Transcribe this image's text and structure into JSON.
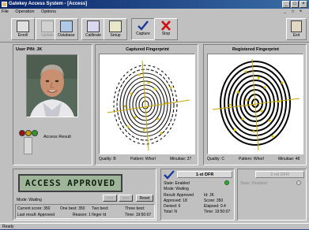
{
  "window": {
    "title": "Gatekey Access System - [Access]",
    "controls": {
      "minimize": "_",
      "maximize": "□",
      "close": "×"
    },
    "inner_controls": {
      "minimize": "_",
      "restore": "□",
      "close": "×"
    }
  },
  "menu": [
    "File",
    "Operation",
    "Options"
  ],
  "toolbar": {
    "enroll": "Enroll",
    "update": "Update",
    "database": "Database",
    "calibrate": "Calibrate",
    "setup": "Setup",
    "capture": "Capture",
    "stop": "Stop",
    "exit": "Exit"
  },
  "user": {
    "pin_label": "User PIN:  JK"
  },
  "captured": {
    "title": "Captured Fingerprint",
    "quality": "Quality: B",
    "pattern": "Pattern: Whorl",
    "minutiae": "Minutiae:  37"
  },
  "registered": {
    "title": "Registered Fingerprint",
    "quality": "Quality: C",
    "pattern": "Pattern: Whorl",
    "minutiae": "Minutiae:  48"
  },
  "access": {
    "result_label": "Access Result",
    "message": "ACCESS  APPROVED",
    "btn_prev": "<<<",
    "btn_next": ">>>",
    "btn_reset": "Reset",
    "mode": "Mode:  Waiting",
    "current_score": "Current score: 350",
    "one_best": "One best: 350",
    "two_best": "Two best:",
    "three_best": "Three best:",
    "last_result": "Last result: Approved",
    "reason": "Reason: 1 finger Id",
    "time": "Time: 19:50:07"
  },
  "dfr1": {
    "title": "1-st DFR",
    "state": "State:  Enabled",
    "mode": "Mode:  Waiting",
    "result": "Result:  Approved",
    "id": "Id:  JK",
    "approved": "Approved:  18",
    "score": "Score:  350",
    "denied": "Denied:  6",
    "elapsed": "Elapsed:  0.4",
    "total": "Total:  N",
    "time": "Time:  19:50:07"
  },
  "dfr2": {
    "title": "2-nd DFR",
    "state": "State:  Disabled"
  },
  "status": "Ready"
}
